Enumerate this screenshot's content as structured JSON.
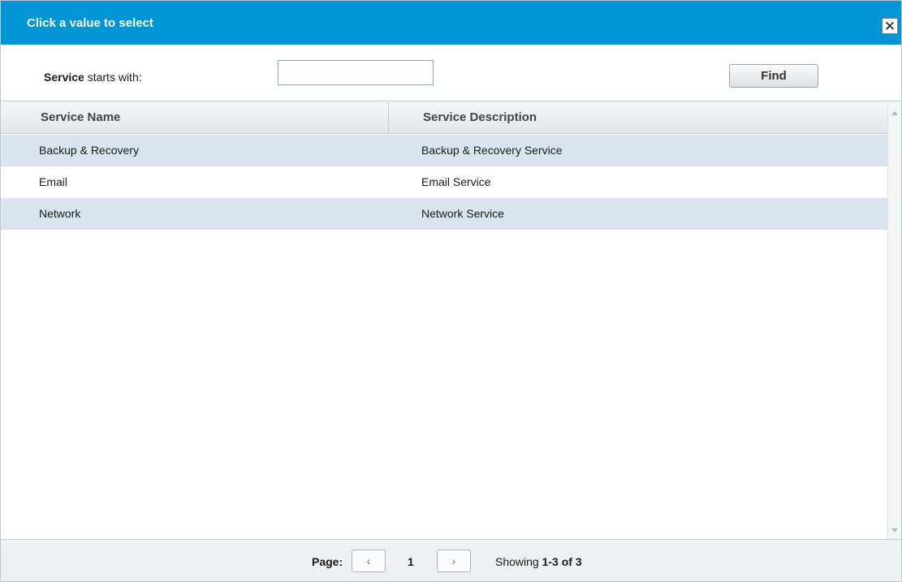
{
  "dialog": {
    "title": "Click a value to select",
    "close_symbol": "✕"
  },
  "search": {
    "label_bold": "Service",
    "label_rest": " starts with:",
    "value": "",
    "placeholder": "",
    "find_label": "Find"
  },
  "table": {
    "columns": [
      "Service Name",
      "Service Description"
    ],
    "rows": [
      {
        "name": "Backup & Recovery",
        "description": "Backup & Recovery Service"
      },
      {
        "name": "Email",
        "description": "Email Service"
      },
      {
        "name": "Network",
        "description": "Network Service"
      }
    ]
  },
  "pager": {
    "page_label": "Page:",
    "prev_symbol": "‹",
    "next_symbol": "›",
    "current_page": "1",
    "showing_prefix": "Showing ",
    "showing_range": "1-3 of 3"
  },
  "colors": {
    "titlebar": "#0096d6",
    "row_alt": "#d9e4ef"
  },
  "icons": {
    "close": "close-icon",
    "prev": "chevron-left-icon",
    "next": "chevron-right-icon",
    "scroll_up": "scroll-up-arrow-icon",
    "scroll_down": "scroll-down-arrow-icon"
  }
}
